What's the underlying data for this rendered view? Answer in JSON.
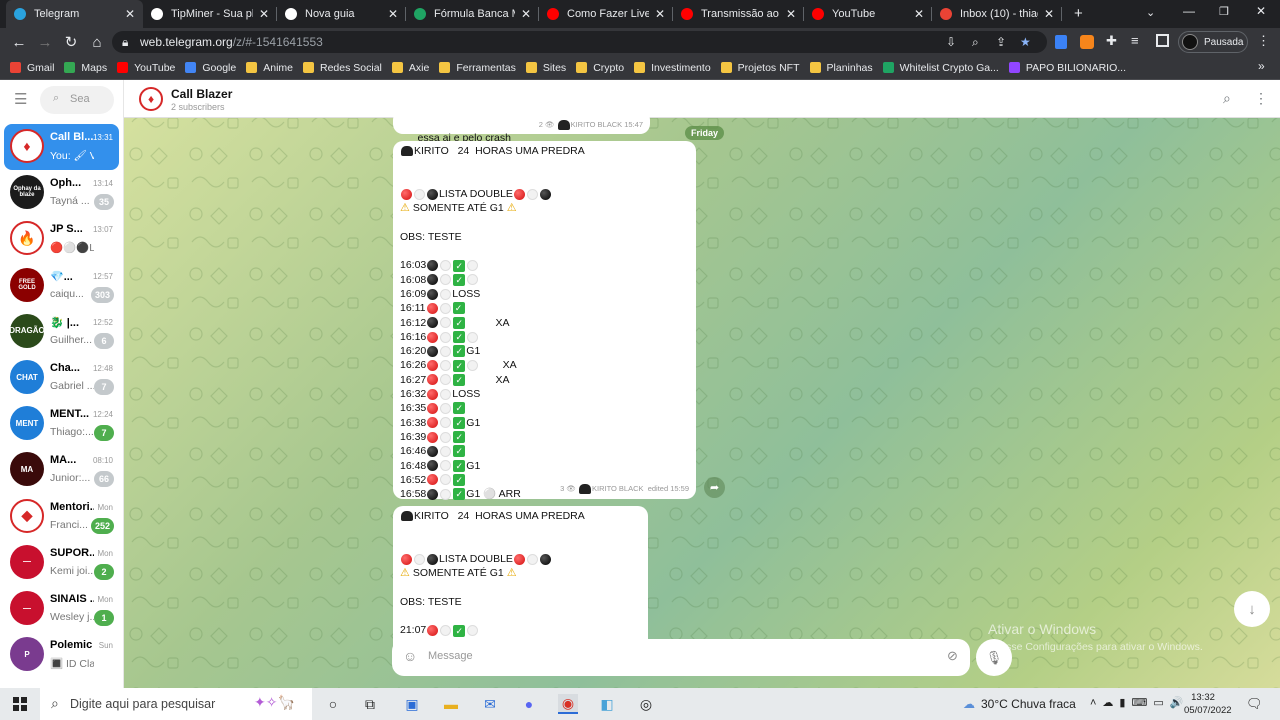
{
  "browser": {
    "tabs": [
      {
        "title": "Telegram",
        "icon": "telegram-icon",
        "color": "#2aa3df",
        "active": true
      },
      {
        "title": "TipMiner - Sua pla",
        "icon": "tipminer-icon",
        "color": "#ffffff"
      },
      {
        "title": "Nova guia",
        "icon": "chrome-icon",
        "color": "#ffffff"
      },
      {
        "title": "Fórmula Banca Mil",
        "icon": "sheets-icon",
        "color": "#1fa463"
      },
      {
        "title": "Como Fazer Live n",
        "icon": "youtube-icon",
        "color": "#ff0000"
      },
      {
        "title": "Transmissão ao viv",
        "icon": "youtube-icon",
        "color": "#ff0000"
      },
      {
        "title": "YouTube",
        "icon": "youtube-icon",
        "color": "#ff0000"
      },
      {
        "title": "Inbox (10) - thiago",
        "icon": "gmail-icon",
        "color": "#ea4335"
      }
    ],
    "url_host": "web.telegram.org",
    "url_path": "/z/#-1541641553",
    "profile_label": "Pausada",
    "bookmarks": [
      {
        "label": "Gmail",
        "icon": "gmail-icon",
        "color": "#ea4335"
      },
      {
        "label": "Maps",
        "icon": "maps-icon",
        "color": "#34a853"
      },
      {
        "label": "YouTube",
        "icon": "youtube-icon",
        "color": "#ff0000"
      },
      {
        "label": "Google",
        "icon": "google-icon",
        "color": "#4285f4"
      },
      {
        "label": "Anime",
        "icon": "folder-icon"
      },
      {
        "label": "Redes Social",
        "icon": "folder-icon"
      },
      {
        "label": "Axie",
        "icon": "folder-icon"
      },
      {
        "label": "Ferramentas",
        "icon": "folder-icon"
      },
      {
        "label": "Sites",
        "icon": "folder-icon"
      },
      {
        "label": "Crypto",
        "icon": "folder-icon"
      },
      {
        "label": "Investimento",
        "icon": "folder-icon"
      },
      {
        "label": "Projetos NFT",
        "icon": "folder-icon"
      },
      {
        "label": "Planinhas",
        "icon": "folder-icon"
      },
      {
        "label": "Whitelist Crypto Ga...",
        "icon": "sheets-icon",
        "color": "#1fa463"
      },
      {
        "label": "PAPO BILIONARIO...",
        "icon": "twitch-icon",
        "color": "#9146ff"
      }
    ]
  },
  "sidebar": {
    "search_placeholder": "Sea",
    "chats": [
      {
        "name": "Call Bl...",
        "time": "13:31",
        "preview": "You: 🖌 Voi...",
        "badge": "",
        "active": true,
        "color": "#ffffff",
        "avatar_text": "♦"
      },
      {
        "name": "Oph...",
        "time": "13:14",
        "preview": "Tayná ...",
        "badge": "35",
        "color": "#1b1b1b",
        "avatar_text": "Ophay da blaze"
      },
      {
        "name": "JP S...",
        "time": "13:07",
        "preview": "🔴⚪⚫LIST...",
        "badge": "",
        "color": "#ffffff",
        "avatar_text": "🔥"
      },
      {
        "name": "💎...",
        "time": "12:57",
        "preview": "caiqu...",
        "badge": "303",
        "color": "#8b0000",
        "avatar_text": "FREE GOLD"
      },
      {
        "name": "🐉 |...",
        "time": "12:52",
        "preview": "Guilher...",
        "badge": "6",
        "color": "#2b4a1a",
        "avatar_text": "DRAGÃO"
      },
      {
        "name": "Cha...",
        "time": "12:48",
        "preview": "Gabriel ...",
        "badge": "7",
        "color": "#1f7ed8",
        "avatar_text": "CHAT"
      },
      {
        "name": "MENT...",
        "time": "12:24",
        "preview": "Thiago:...",
        "badge": "7",
        "badge_green": true,
        "color": "#1f7ed8",
        "avatar_text": "MENT"
      },
      {
        "name": "MA...",
        "time": "08:10",
        "preview": "Junior:...",
        "badge": "66",
        "color": "#3a0a0a",
        "avatar_text": "MA"
      },
      {
        "name": "Mentori...",
        "time": "Mon",
        "preview": "Franci...",
        "badge": "252",
        "badge_green": true,
        "color": "#ffffff",
        "avatar_text": "◆"
      },
      {
        "name": "SUPOR...",
        "time": "Mon",
        "preview": "Kemi joi...",
        "badge": "2",
        "badge_green": true,
        "color": "#c8102e",
        "avatar_text": "—"
      },
      {
        "name": "SINAIS ...",
        "time": "Mon",
        "preview": "Wesley j...",
        "badge": "1",
        "badge_green": true,
        "color": "#c8102e",
        "avatar_text": "—"
      },
      {
        "name": "Polemic ...",
        "time": "Sun",
        "preview": "🔳 ID Class...",
        "badge": "",
        "color": "#7a3b8f",
        "avatar_text": "P"
      }
    ]
  },
  "chat": {
    "title": "Call Blazer",
    "subtitle": "2 subscribers",
    "date_chip": "Friday",
    "composer_placeholder": "Message",
    "prev_message": {
      "text": "essa ai e pelo crash",
      "meta_views": "2",
      "meta_sig": "KIRITO BLACK",
      "time": "15:47"
    },
    "messages": [
      {
        "header": "KIRITO   24  HORAS UMA PREDRA",
        "title": "LISTA DOUBLE",
        "warning": "SOMENTE ATÉ G1",
        "obs": "OBS: TESTE",
        "rows": [
          {
            "time": "16:03",
            "seq": "b w c w",
            "note": ""
          },
          {
            "time": "16:08",
            "seq": "b w c w",
            "note": ""
          },
          {
            "time": "16:09",
            "seq": "b w",
            "note": "LOSS"
          },
          {
            "time": "16:11",
            "seq": "r w c",
            "note": ""
          },
          {
            "time": "16:12",
            "seq": "b w c",
            "note": "          XA"
          },
          {
            "time": "16:16",
            "seq": "r w c w",
            "note": ""
          },
          {
            "time": "16:20",
            "seq": "b w c",
            "note": "G1"
          },
          {
            "time": "16:26",
            "seq": "r w c w",
            "note": "        XA"
          },
          {
            "time": "16:27",
            "seq": "r w c",
            "note": "          XA"
          },
          {
            "time": "16:32",
            "seq": "r w",
            "note": "LOSS"
          },
          {
            "time": "16:35",
            "seq": "r w c",
            "note": ""
          },
          {
            "time": "16:38",
            "seq": "r w c",
            "note": "G1"
          },
          {
            "time": "16:39",
            "seq": "r w c",
            "note": ""
          },
          {
            "time": "16:46",
            "seq": "b w c",
            "note": ""
          },
          {
            "time": "16:48",
            "seq": "b w c",
            "note": "G1"
          },
          {
            "time": "16:52",
            "seq": "r w c",
            "note": ""
          },
          {
            "time": "16:58",
            "seq": "b w c",
            "note": "G1 ⚪ ARR"
          }
        ],
        "meta_views": "3",
        "meta_sig": "KIRITO BLACK",
        "time": "edited 15:59"
      },
      {
        "header": "KIRITO   24  HORAS UMA PREDRA",
        "title": "LISTA DOUBLE",
        "warning": "SOMENTE ATÉ G1",
        "obs": "OBS: TESTE",
        "rows": [
          {
            "time": "21:07",
            "seq": "r w c w",
            "note": ""
          }
        ]
      }
    ]
  },
  "watermark": {
    "title": "Ativar o Windows",
    "subtitle": "Acesse Configurações para ativar o Windows."
  },
  "taskbar": {
    "search_placeholder": "Digite aqui para pesquisar",
    "weather_temp": "30°C",
    "weather_desc": "Chuva fraca",
    "time": "13:32",
    "date": "05/07/2022"
  }
}
